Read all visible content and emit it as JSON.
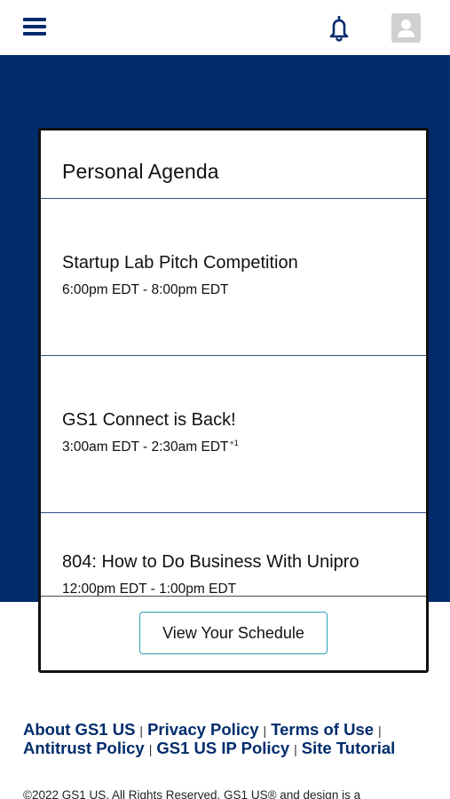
{
  "header": {
    "menu_icon": "hamburger-menu-icon",
    "notifications_icon": "bell-icon",
    "profile_icon": "user-avatar-icon"
  },
  "colors": {
    "brand_navy": "#002c6c",
    "button_border": "#2aa0b3",
    "divider": "#2e4f86"
  },
  "agenda": {
    "title": "Personal Agenda",
    "items": [
      {
        "name": "Startup Lab Pitch Competition",
        "time": "6:00pm EDT - 8:00pm EDT",
        "day_offset": ""
      },
      {
        "name": "GS1 Connect is Back!",
        "time": "3:00am EDT - 2:30am EDT",
        "day_offset": "+1"
      },
      {
        "name": "804: How to Do Business With Unipro",
        "time": "12:00pm EDT - 1:00pm EDT",
        "day_offset": ""
      }
    ],
    "view_schedule_label": "View Your Schedule"
  },
  "footer": {
    "links": {
      "about": "About GS1 US",
      "privacy": "Privacy Policy",
      "terms": "Terms of Use",
      "antitrust": "Antitrust Policy",
      "ip_policy": "GS1 US IP Policy",
      "tutorial": "Site Tutorial"
    },
    "separator": "|",
    "copyright": "©2022 GS1 US. All Rights Reserved. GS1 US® and design is a"
  }
}
